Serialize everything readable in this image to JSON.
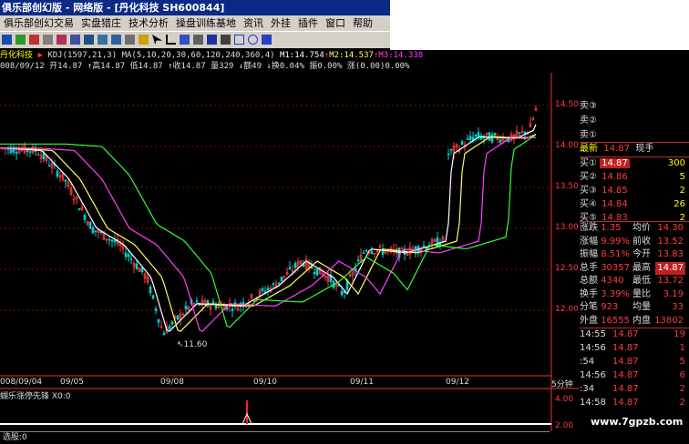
{
  "window": {
    "title": "俱乐部创幻版 - 网络版 - [丹化科技 SH600844]"
  },
  "menu": [
    "俱乐部创幻交易",
    "实盘猎庄",
    "技术分析",
    "操盘训练基地",
    "资讯",
    "外挂",
    "插件",
    "窗口",
    "帮助"
  ],
  "indicator_bar": {
    "stock_name": "丹化科技",
    "kdj": "KDJ(1597,21,3)",
    "ma": "MA(5,10,20,30,60,120,240,360,4)",
    "m1": "M1:14.754",
    "m2": "M2:14.537",
    "m3": "M3:14.338"
  },
  "quote_line": "008/09/12 开14.87 ↑高14.87 低14.87 ↑收14.87 量329 ↓额49 ↓换0.04% 振0.00% 涨(0.00)0.00%",
  "price_axis": [
    "14.50",
    "14.00",
    "13.50",
    "13.00",
    "12.50",
    "12.00"
  ],
  "date_axis": [
    "008/09/04",
    "09/05",
    "09/08",
    "09/10",
    "09/11",
    "09/12",
    "5分钟"
  ],
  "low_marker": "11.60",
  "indicator_pane": {
    "title": "蝴乐涨停先锋 X0:0",
    "axis": [
      "4.00",
      "2.00"
    ]
  },
  "bottom_label": "选股:0",
  "watermark": "www.7gpzb.com",
  "orderbook": {
    "sells": [
      "卖③",
      "卖②",
      "卖①"
    ],
    "last": {
      "label": "最新",
      "price": "14.87",
      "extra": "现手"
    },
    "buys": [
      {
        "label": "买①",
        "price": "14.87",
        "vol": "300"
      },
      {
        "label": "买②",
        "price": "14.86",
        "vol": "5"
      },
      {
        "label": "买③",
        "price": "14.85",
        "vol": "2"
      },
      {
        "label": "买④",
        "price": "14.84",
        "vol": "26"
      },
      {
        "label": "买⑤",
        "price": "14.83",
        "vol": "2"
      }
    ]
  },
  "stats": [
    {
      "l1": "涨跌",
      "v1": "1.35",
      "l2": "均价",
      "v2": "14.30"
    },
    {
      "l1": "涨幅",
      "v1": "9.99%",
      "l2": "前收",
      "v2": "13.52"
    },
    {
      "l1": "振幅",
      "v1": "8.51%",
      "l2": "今开",
      "v2": "13.83"
    },
    {
      "l1": "总手",
      "v1": "30357",
      "l2": "最高",
      "v2": "14.87"
    },
    {
      "l1": "总额",
      "v1": "4340",
      "l2": "最低",
      "v2": "13.72"
    },
    {
      "l1": "换手",
      "v1": "3.39%",
      "l2": "量比",
      "v2": "3.19"
    },
    {
      "l1": "分笔",
      "v1": "923",
      "l2": "均量",
      "v2": "33"
    },
    {
      "l1": "外盘",
      "v1": "16555",
      "l2": "内盘",
      "v2": "13802"
    }
  ],
  "ticks": [
    {
      "time": "14:55",
      "price": "14.87",
      "vol": "19"
    },
    {
      "time": "14:56",
      "price": "14.87",
      "vol": "1"
    },
    {
      "time": ":54",
      "price": "14.87",
      "vol": "5"
    },
    {
      "time": "14:56",
      "price": "14.87",
      "vol": "6"
    },
    {
      "time": ":34",
      "price": "14.87",
      "vol": "2"
    },
    {
      "time": "14:58",
      "price": "14.87",
      "vol": "2"
    }
  ],
  "colors": {
    "up": "#ff3c3c",
    "down": "#00d0d0",
    "white": "#ffffff",
    "ma5": "#ffffff",
    "ma10": "#ffff60",
    "ma20": "#ff40ff",
    "ma30": "#30ff30"
  }
}
